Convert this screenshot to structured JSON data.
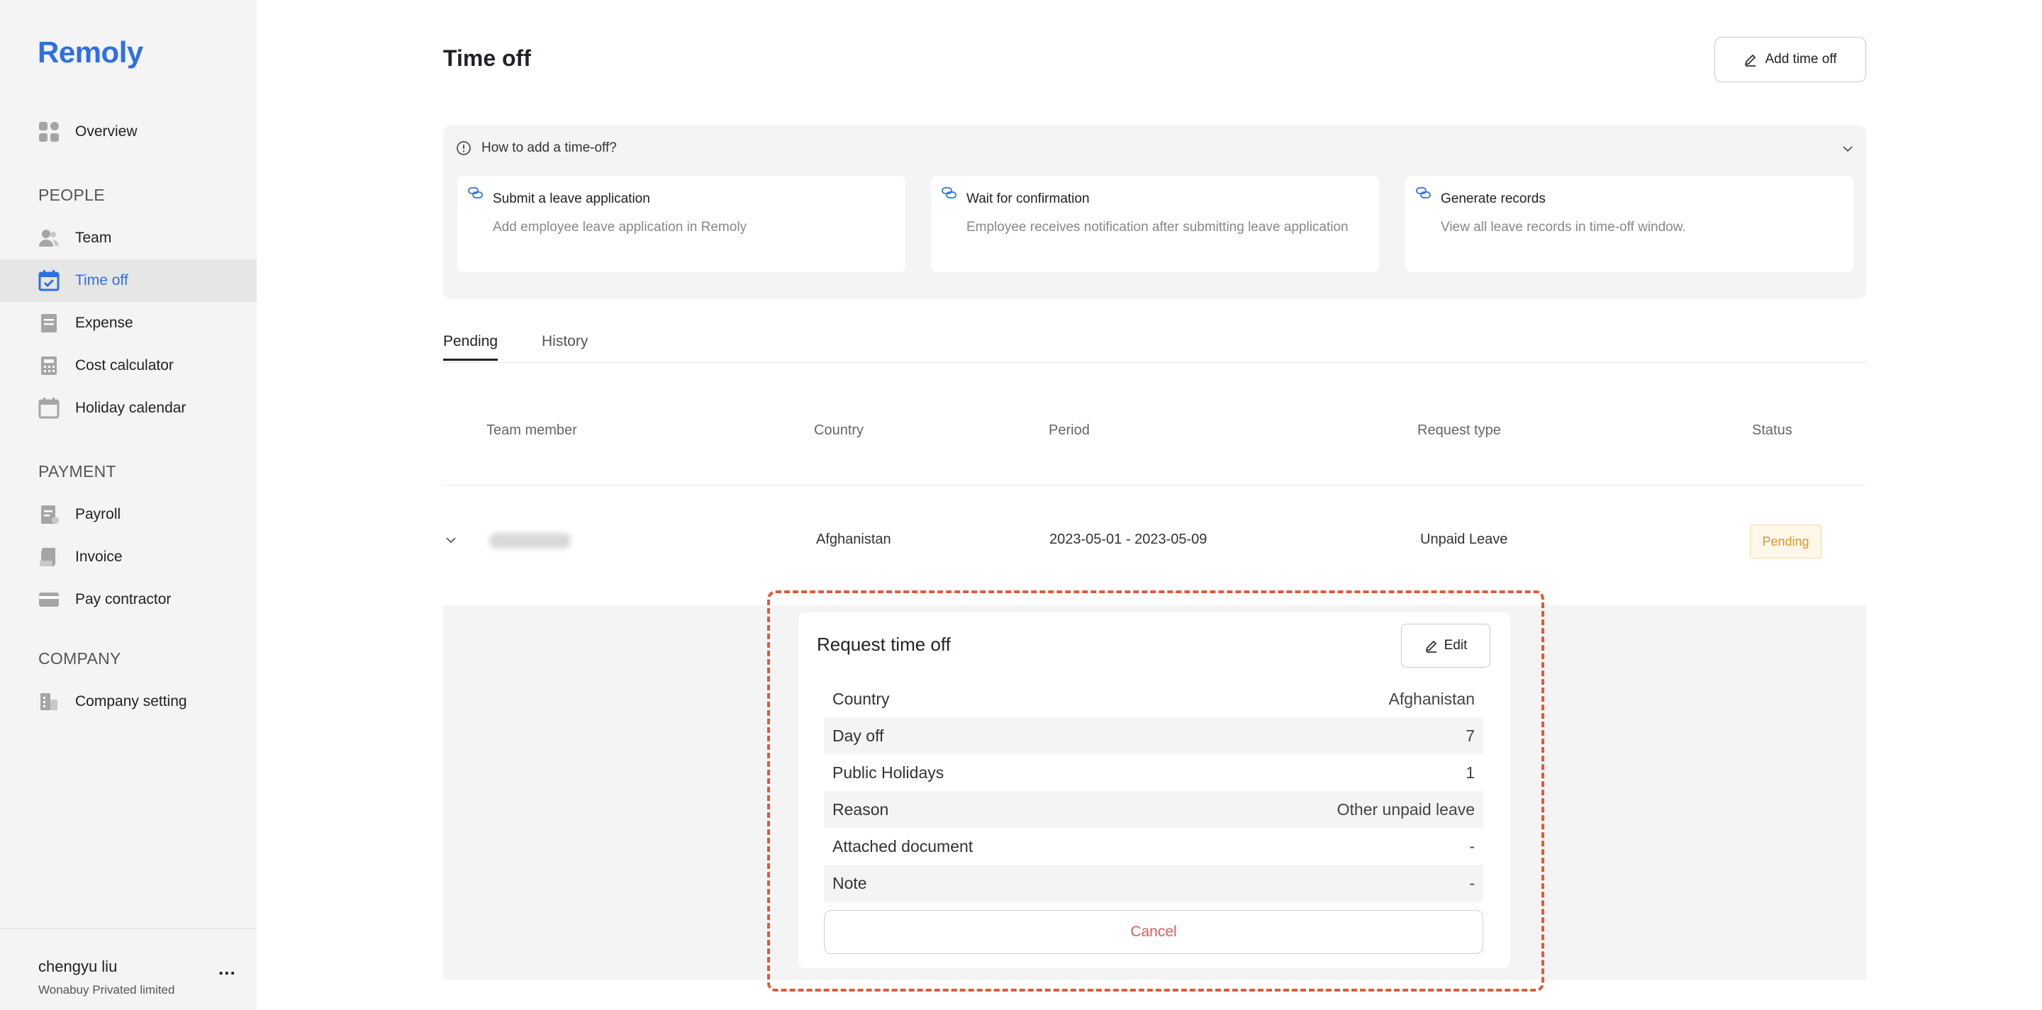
{
  "app": {
    "logo": "Remoly"
  },
  "sidebar": {
    "overview": "Overview",
    "sections": {
      "people": "PEOPLE",
      "payment": "PAYMENT",
      "company": "COMPANY"
    },
    "people_items": [
      "Team",
      "Time off",
      "Expense",
      "Cost calculator",
      "Holiday calendar"
    ],
    "payment_items": [
      "Payroll",
      "Invoice",
      "Pay contractor"
    ],
    "company_items": [
      "Company setting"
    ],
    "active_item": "Time off",
    "user": {
      "name": "chengyu liu",
      "org": "Wonabuy Privated limited",
      "more": "..."
    }
  },
  "page": {
    "title": "Time off",
    "add_button": "Add time off"
  },
  "howto": {
    "question": "How to add a time-off?",
    "steps": [
      {
        "title": "Submit a leave application",
        "desc": "Add employee leave application in Remoly"
      },
      {
        "title": "Wait for confirmation",
        "desc": "Employee receives notification after submitting leave application"
      },
      {
        "title": "Generate records",
        "desc": "View all leave records in time-off window."
      }
    ]
  },
  "tabs": [
    {
      "label": "Pending",
      "active": true
    },
    {
      "label": "History",
      "active": false
    }
  ],
  "table": {
    "headers": [
      "Team member",
      "Country",
      "Period",
      "Request type",
      "Status"
    ],
    "rows": [
      {
        "member": "",
        "country": "Afghanistan",
        "period": "2023-05-01 - 2023-05-09",
        "type": "Unpaid Leave",
        "status": "Pending"
      }
    ]
  },
  "detail": {
    "title": "Request time off",
    "edit_label": "Edit",
    "fields": [
      {
        "label": "Country",
        "value": "Afghanistan"
      },
      {
        "label": "Day off",
        "value": "7"
      },
      {
        "label": "Public Holidays",
        "value": "1"
      },
      {
        "label": "Reason",
        "value": "Other unpaid leave"
      },
      {
        "label": "Attached document",
        "value": "-"
      },
      {
        "label": "Note",
        "value": "-"
      }
    ],
    "cancel_label": "Cancel"
  },
  "colors": {
    "brand": "#2f6fe4",
    "pending_text": "#e0962a",
    "cancel_text": "#e05a5a",
    "highlight_frame": "#e05a3a"
  }
}
